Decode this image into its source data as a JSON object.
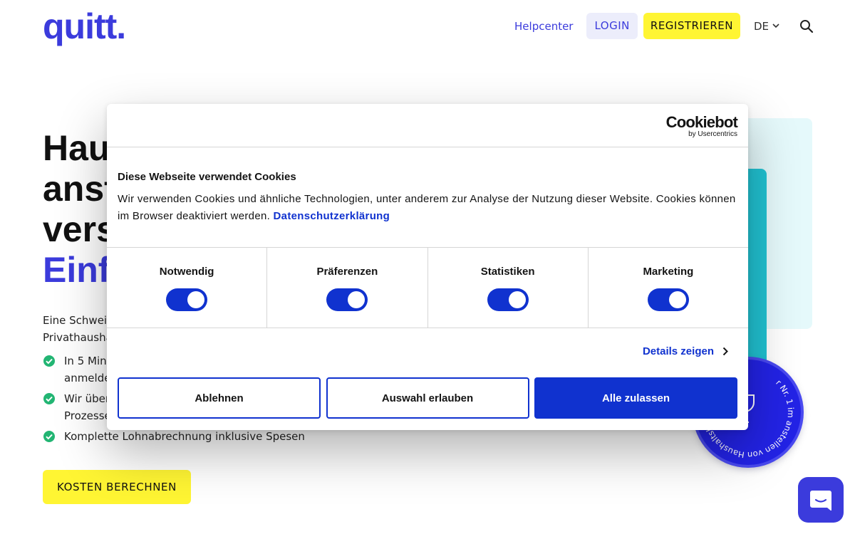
{
  "header": {
    "logo": "quitt.",
    "nav": {
      "help": "Helpcenter",
      "login": "LOGIN",
      "register": "REGISTRIEREN",
      "language": "DE"
    }
  },
  "hero": {
    "title_lines": [
      "Hau",
      "anst",
      "vers"
    ],
    "title_accent": "Einfa",
    "intro_lines": [
      "Eine Schweiz",
      "Privathausha"
    ],
    "features": [
      "In 5 Minu",
      "anmelde",
      "Wir über",
      "Prozesse",
      "Komplette Lohnabrechnung inklusive Spesen"
    ],
    "cta": "KOSTEN BERECHNEN"
  },
  "badge": {
    "text": "r Nr. 1 im anstellen von Haushaltshilfe"
  },
  "cookie_dialog": {
    "brand": "Cookiebot",
    "brand_sub": "by Usercentrics",
    "title": "Diese Webseite verwendet Cookies",
    "text": "Wir verwenden Cookies und ähnliche Technologien, unter anderem zur Analyse der Nutzung dieser Website. Cookies können im Browser deaktiviert werden.",
    "privacy_link": "Datenschutzerklärung",
    "categories": [
      {
        "label": "Notwendig",
        "enabled": true
      },
      {
        "label": "Präferenzen",
        "enabled": true
      },
      {
        "label": "Statistiken",
        "enabled": true
      },
      {
        "label": "Marketing",
        "enabled": true
      }
    ],
    "details": "Details zeigen",
    "buttons": {
      "reject": "Ablehnen",
      "allow_selection": "Auswahl erlauben",
      "allow_all": "Alle zulassen"
    }
  },
  "colors": {
    "brand": "#3b3bdc",
    "highlight": "#fff533",
    "cookiebot_blue": "#1032cf",
    "check_green": "#22b573"
  },
  "icons": {
    "search": "search-icon",
    "language_dropdown": "chevron-down-icon",
    "feature_check": "check-circle-icon",
    "details_arrow": "chevron-right-icon",
    "chat": "chat-icon"
  }
}
